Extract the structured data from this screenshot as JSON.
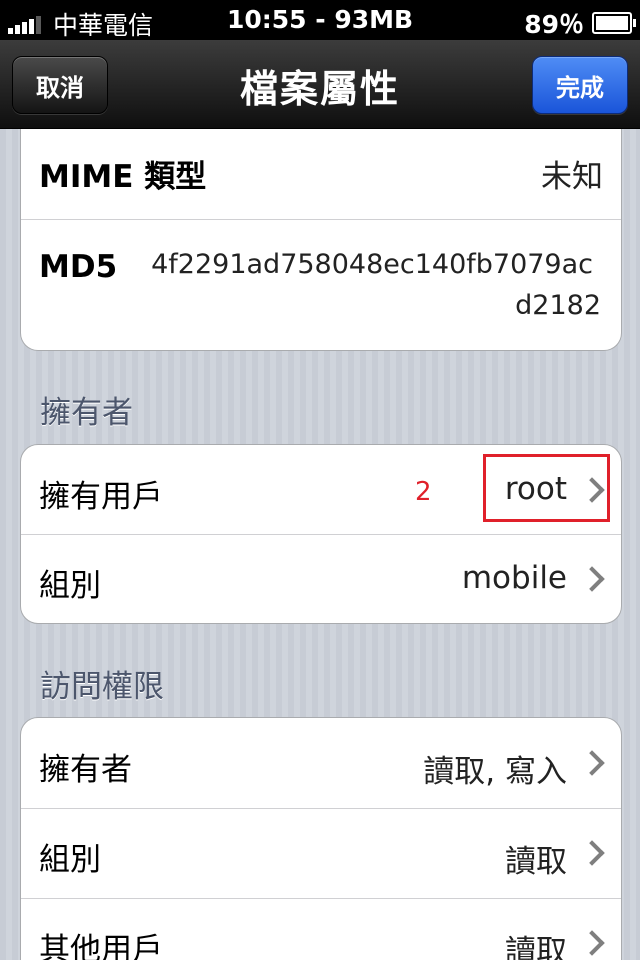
{
  "status_bar": {
    "carrier": "中華電信",
    "center": "10:55 - 93MB",
    "battery": "89％",
    "battery_level": 0.89
  },
  "navbar": {
    "title": "檔案屬性",
    "cancel": "取消",
    "done": "完成"
  },
  "info": {
    "mime_label": "MIME 類型",
    "mime_value": "未知",
    "md5_label": "MD5",
    "md5_value_line1": "4f2291ad758048ec140fb7079ac",
    "md5_value_line2": "d2182"
  },
  "owner_section": {
    "header": "擁有者",
    "rows": [
      {
        "label": "擁有用戶",
        "value": "root"
      },
      {
        "label": "組別",
        "value": "mobile"
      }
    ]
  },
  "access_section": {
    "header": "訪問權限",
    "rows": [
      {
        "label": "擁有者",
        "value": "讀取, 寫入"
      },
      {
        "label": "組別",
        "value": "讀取"
      },
      {
        "label": "其他用戶",
        "value": "讀取"
      }
    ]
  },
  "annotation": {
    "number": "2",
    "color": "#e0202a"
  }
}
